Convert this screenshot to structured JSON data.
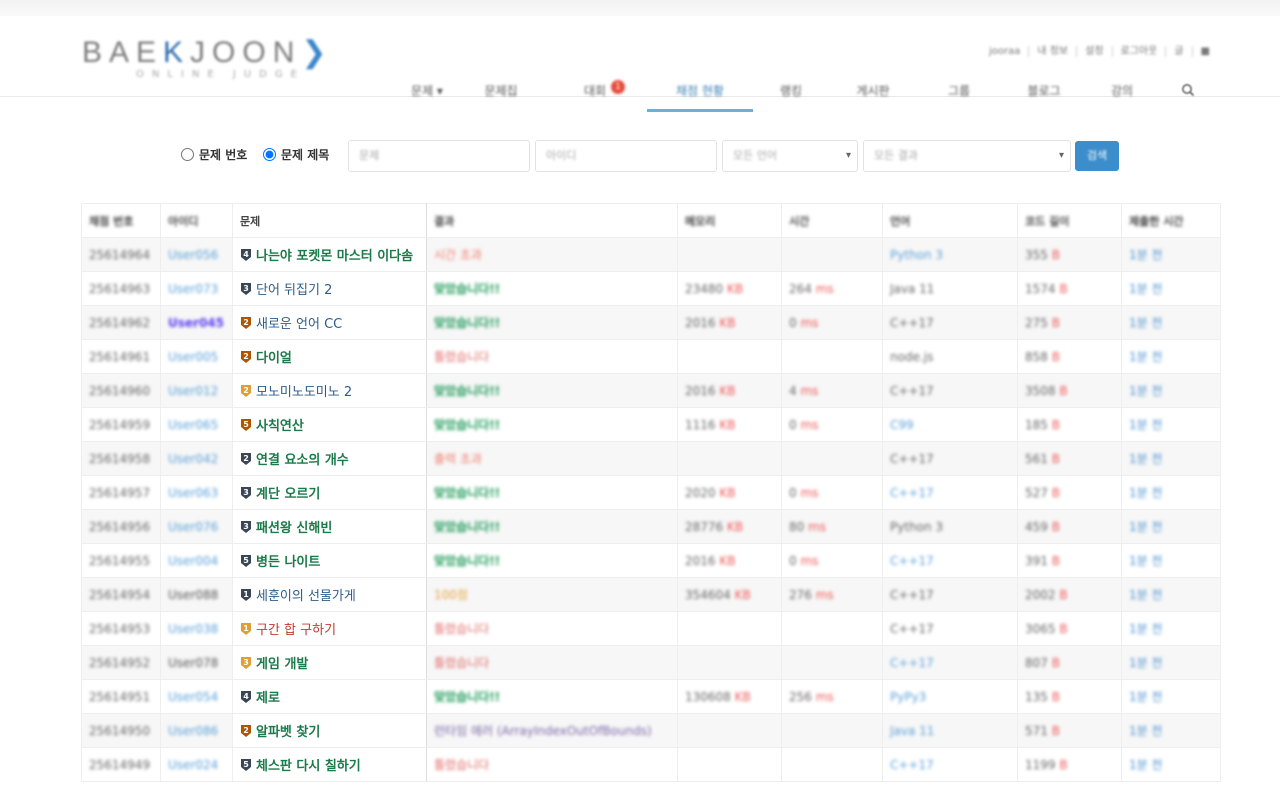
{
  "logo": {
    "word_a": "BAE",
    "word_k": "K",
    "word_b": "JOON",
    "chevron": "❯",
    "sub": "ONLINE JUDGE"
  },
  "util_links": [
    "jooraa",
    "내 정보",
    "설정",
    "로그아웃",
    "글",
    "■"
  ],
  "nav": {
    "tabs": [
      "문제 ▾",
      "문제집",
      "대회",
      "채점 현황",
      "랭킹",
      "게시판",
      "그룹",
      "블로그",
      "강의",
      "search-icon"
    ],
    "contest_badge": "1"
  },
  "search": {
    "radio_number": "문제 번호",
    "radio_title": "문제 제목",
    "problem_placeholder": "문제",
    "user_placeholder": "아이디",
    "language_select": "모든 언어",
    "result_select": "모든 결과",
    "button": "검색"
  },
  "table": {
    "headers": [
      "채점 번호",
      "아이디",
      "문제",
      "결과",
      "메모리",
      "시간",
      "언어",
      "코드 길이",
      "제출한 시간"
    ],
    "rows": [
      {
        "id": "25614964",
        "user": "User056",
        "ustyle": "",
        "tier": "4",
        "tcolor": "#3a4656",
        "title": "나는야 포켓몬 마스터 이다솜",
        "pstyle": "green",
        "result": "시간 초과",
        "rstyle": "r-tle",
        "memory": "",
        "time": "",
        "lang": "Python 3",
        "lstyle": "lang-blue",
        "len": "355",
        "sub": "1분 전"
      },
      {
        "id": "25614963",
        "user": "User073",
        "ustyle": "",
        "tier": "3",
        "tcolor": "#3a4656",
        "title": "단어 뒤집기 2",
        "pstyle": "blue",
        "result": "맞았습니다!!",
        "rstyle": "r-ac",
        "memory": "23480",
        "time": "264",
        "lang": "Java 11",
        "lstyle": "lang-gray",
        "len": "1574",
        "sub": "1분 전"
      },
      {
        "id": "25614962",
        "user": "User045",
        "ustyle": "purple",
        "tier": "2",
        "tcolor": "#ad5600",
        "title": "새로운 언어 CC",
        "pstyle": "blue",
        "result": "맞았습니다!!",
        "rstyle": "r-ac",
        "memory": "2016",
        "time": "0",
        "lang": "C++17",
        "lstyle": "lang-gray",
        "len": "275",
        "sub": "1분 전"
      },
      {
        "id": "25614961",
        "user": "User005",
        "ustyle": "",
        "tier": "2",
        "tcolor": "#ad5600",
        "title": "다이얼",
        "pstyle": "green",
        "result": "틀렸습니다",
        "rstyle": "r-wa",
        "memory": "",
        "time": "",
        "lang": "node.js",
        "lstyle": "lang-gray",
        "len": "858",
        "sub": "1분 전"
      },
      {
        "id": "25614960",
        "user": "User012",
        "ustyle": "",
        "tier": "2",
        "tcolor": "#e09e37",
        "title": "모노미노도미노 2",
        "pstyle": "blue",
        "result": "맞았습니다!!",
        "rstyle": "r-ac",
        "memory": "2016",
        "time": "4",
        "lang": "C++17",
        "lstyle": "lang-gray",
        "len": "3508",
        "sub": "1분 전"
      },
      {
        "id": "25614959",
        "user": "User065",
        "ustyle": "",
        "tier": "5",
        "tcolor": "#ad5600",
        "title": "사칙연산",
        "pstyle": "green",
        "result": "맞았습니다!!",
        "rstyle": "r-ac",
        "memory": "1116",
        "time": "0",
        "lang": "C99",
        "lstyle": "lang-blue",
        "len": "185",
        "sub": "1분 전"
      },
      {
        "id": "25614958",
        "user": "User042",
        "ustyle": "",
        "tier": "2",
        "tcolor": "#3a4656",
        "title": "연결 요소의 개수",
        "pstyle": "green",
        "result": "출력 초과",
        "rstyle": "r-tle",
        "memory": "",
        "time": "",
        "lang": "C++17",
        "lstyle": "lang-gray",
        "len": "561",
        "sub": "1분 전"
      },
      {
        "id": "25614957",
        "user": "User063",
        "ustyle": "",
        "tier": "3",
        "tcolor": "#3a4656",
        "title": "계단 오르기",
        "pstyle": "green",
        "result": "맞았습니다!!",
        "rstyle": "r-ac",
        "memory": "2020",
        "time": "0",
        "lang": "C++17",
        "lstyle": "lang-blue",
        "len": "527",
        "sub": "1분 전"
      },
      {
        "id": "25614956",
        "user": "User076",
        "ustyle": "",
        "tier": "3",
        "tcolor": "#3a4656",
        "title": "패션왕 신해빈",
        "pstyle": "green",
        "result": "맞았습니다!!",
        "rstyle": "r-ac",
        "memory": "28776",
        "time": "80",
        "lang": "Python 3",
        "lstyle": "lang-gray",
        "len": "459",
        "sub": "1분 전"
      },
      {
        "id": "25614955",
        "user": "User004",
        "ustyle": "",
        "tier": "5",
        "tcolor": "#3a4656",
        "title": "병든 나이트",
        "pstyle": "green",
        "result": "맞았습니다!!",
        "rstyle": "r-ac",
        "memory": "2016",
        "time": "0",
        "lang": "C++17",
        "lstyle": "lang-blue",
        "len": "391",
        "sub": "1분 전"
      },
      {
        "id": "25614954",
        "user": "User088",
        "ustyle": "gray",
        "tier": "1",
        "tcolor": "#3a4656",
        "title": "세훈이의 선물가게",
        "pstyle": "blue",
        "result": "100점",
        "rstyle": "r-pc",
        "memory": "354604",
        "time": "276",
        "lang": "C++17",
        "lstyle": "lang-gray",
        "len": "2002",
        "sub": "1분 전"
      },
      {
        "id": "25614953",
        "user": "User038",
        "ustyle": "",
        "tier": "1",
        "tcolor": "#e09e37",
        "title": "구간 합 구하기",
        "pstyle": "red",
        "result": "틀렸습니다",
        "rstyle": "r-wa",
        "memory": "",
        "time": "",
        "lang": "C++17",
        "lstyle": "lang-gray",
        "len": "3065",
        "sub": "1분 전"
      },
      {
        "id": "25614952",
        "user": "User078",
        "ustyle": "gray",
        "tier": "3",
        "tcolor": "#e09e37",
        "title": "게임 개발",
        "pstyle": "green",
        "result": "틀렸습니다",
        "rstyle": "r-wa",
        "memory": "",
        "time": "",
        "lang": "C++17",
        "lstyle": "lang-blue",
        "len": "807",
        "sub": "1분 전"
      },
      {
        "id": "25614951",
        "user": "User054",
        "ustyle": "",
        "tier": "4",
        "tcolor": "#3a4656",
        "title": "제로",
        "pstyle": "green",
        "result": "맞았습니다!!",
        "rstyle": "r-ac",
        "memory": "130608",
        "time": "256",
        "lang": "PyPy3",
        "lstyle": "lang-blue",
        "len": "135",
        "sub": "1분 전"
      },
      {
        "id": "25614950",
        "user": "User086",
        "ustyle": "",
        "tier": "2",
        "tcolor": "#ad5600",
        "title": "알파벳 찾기",
        "pstyle": "green",
        "result": "런타임 에러 (ArrayIndexOutOfBounds)",
        "rstyle": "r-rte",
        "memory": "",
        "time": "",
        "lang": "Java 11",
        "lstyle": "lang-blue",
        "len": "571",
        "sub": "1분 전"
      },
      {
        "id": "25614949",
        "user": "User024",
        "ustyle": "",
        "tier": "5",
        "tcolor": "#3a4656",
        "title": "체스판 다시 칠하기",
        "pstyle": "green",
        "result": "틀렸습니다",
        "rstyle": "r-wa",
        "memory": "",
        "time": "",
        "lang": "C++17",
        "lstyle": "lang-blue",
        "len": "1199",
        "sub": "1분 전"
      }
    ],
    "unit_memory": "KB",
    "unit_time": "ms",
    "unit_len": "B"
  }
}
